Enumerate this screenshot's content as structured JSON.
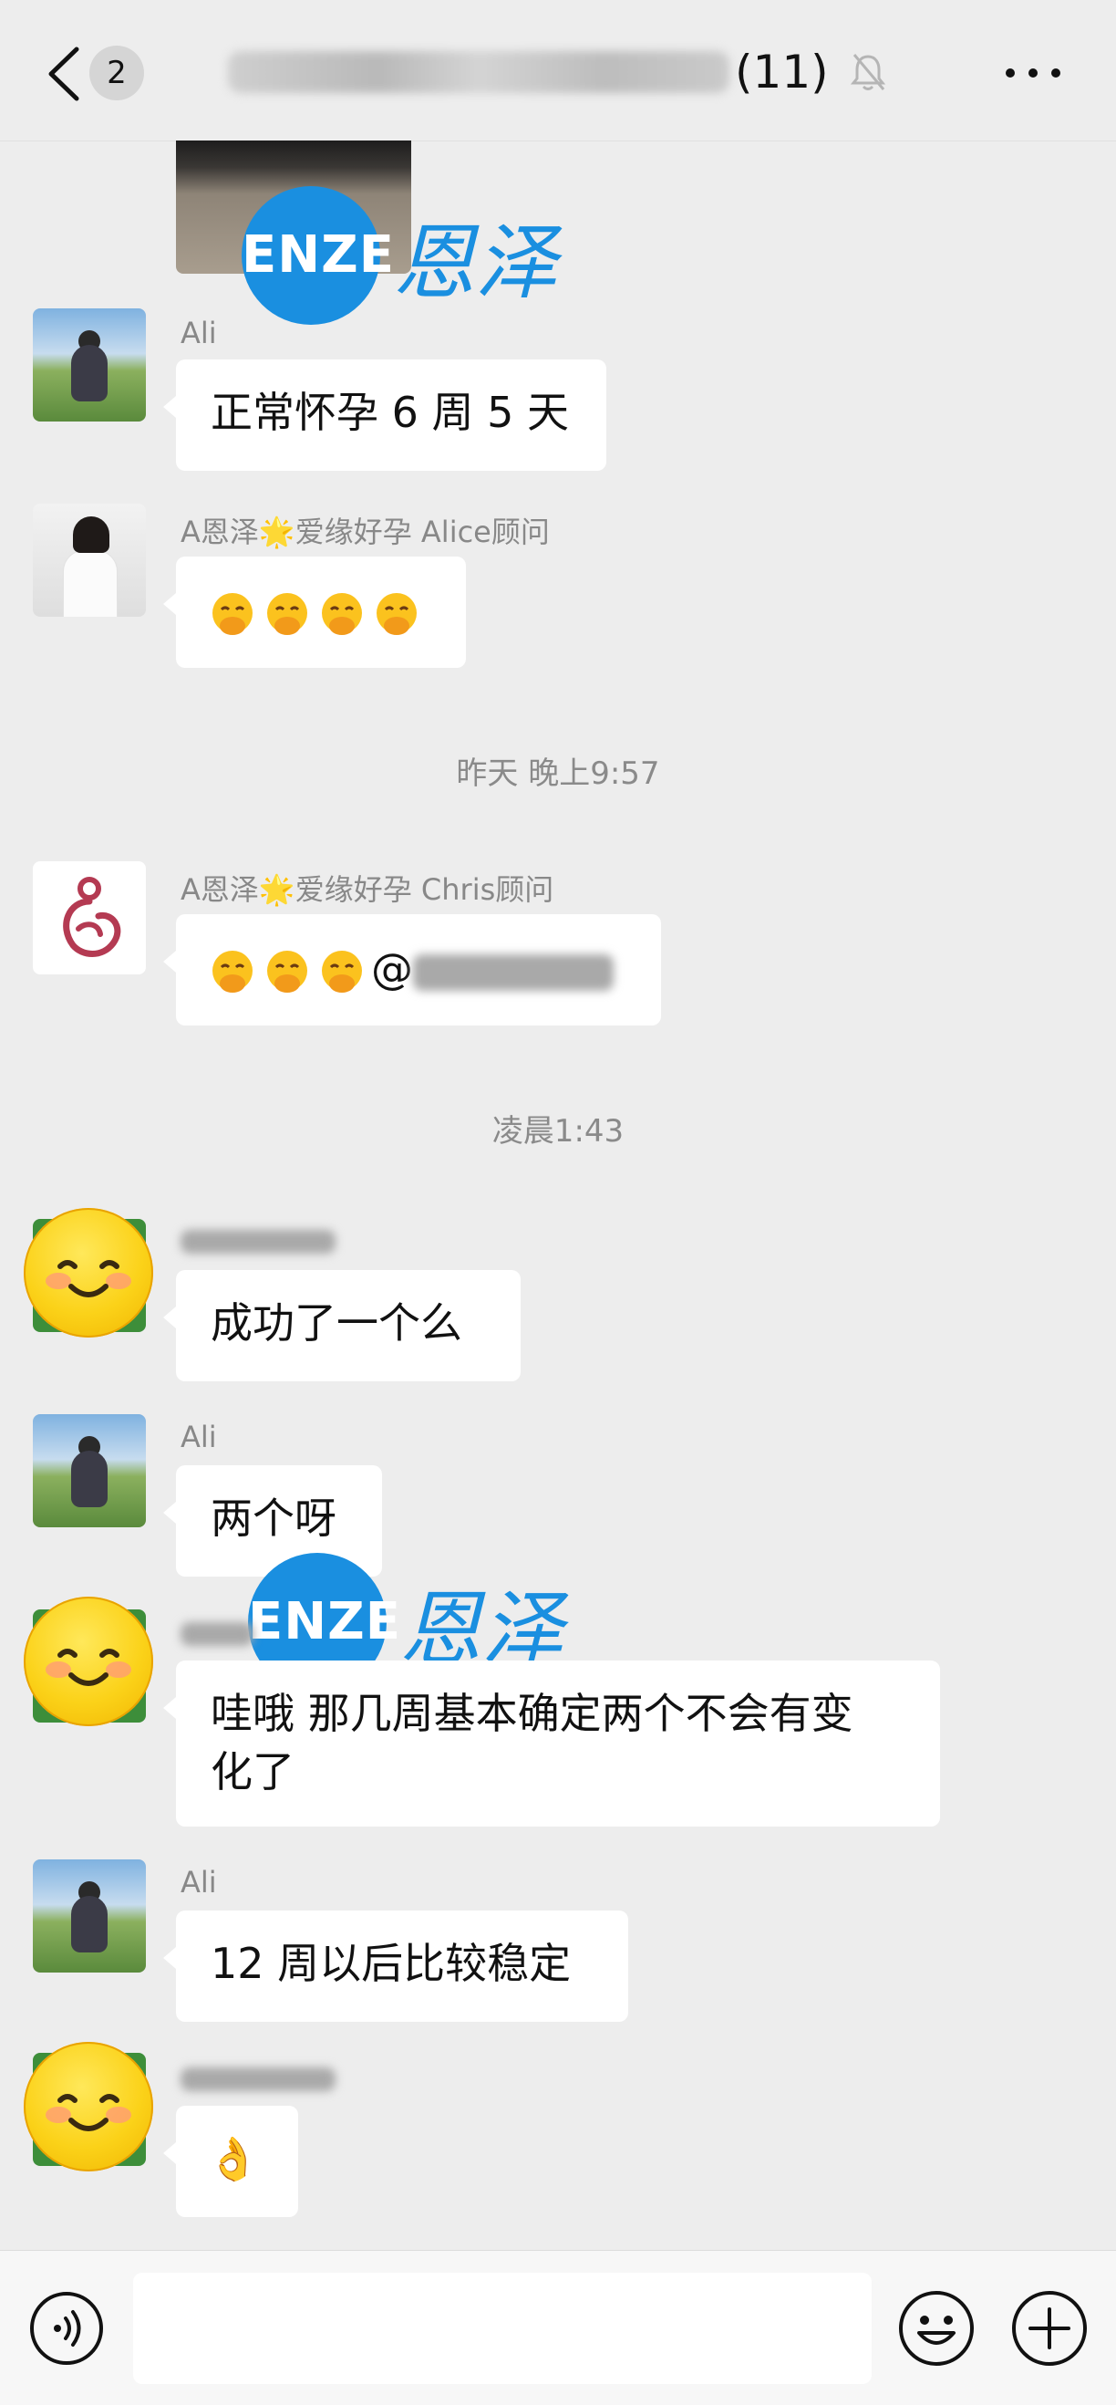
{
  "header": {
    "unread_count": "2",
    "member_count": "(11)"
  },
  "watermark": {
    "logo_text": "ENZE",
    "brand_cn": "恩泽"
  },
  "messages": [
    {
      "sender": "Ali",
      "text": "正常怀孕 6 周 5 天"
    },
    {
      "sender": "A恩泽🌟爱缘好孕 Alice顾问",
      "emoji": "🫢🫢🫢🫢"
    },
    {
      "time": "昨天 晚上9:57"
    },
    {
      "sender": "A恩泽🌟爱缘好孕 Chris顾问",
      "emoji": "🫢🫢🫢",
      "text_suffix": "@"
    },
    {
      "time": "凌晨1:43"
    },
    {
      "text": "成功了一个么"
    },
    {
      "sender": "Ali",
      "text": "两个呀"
    },
    {
      "text": "哇哦 那几周基本确定两个不会有变化了"
    },
    {
      "sender": "Ali",
      "text": "12 周以后比较稳定"
    },
    {
      "emoji": "👌"
    }
  ],
  "labels": {
    "name_ali": "Ali",
    "name_alice": "A恩泽🌟爱缘好孕 Alice顾问",
    "name_chris": "A恩泽🌟爱缘好孕 Chris顾问",
    "time_1": "昨天 晚上9:57",
    "time_2": "凌晨1:43",
    "msg_1": "正常怀孕 6 周 5 天",
    "msg_5": "成功了一个么",
    "msg_6": "两个呀",
    "msg_7_line1": "哇哦 那几周基本确定两个不会有变",
    "msg_7_line2": "化了",
    "msg_8": "12 周以后比较稳定",
    "at_sign": "@",
    "ok_hand": "👌"
  },
  "icons": {
    "back": "chevron-left-icon",
    "mute": "bell-off-icon",
    "more": "more-dots-icon",
    "voice": "voice-icon",
    "emoji": "emoji-icon",
    "plus": "plus-icon"
  }
}
